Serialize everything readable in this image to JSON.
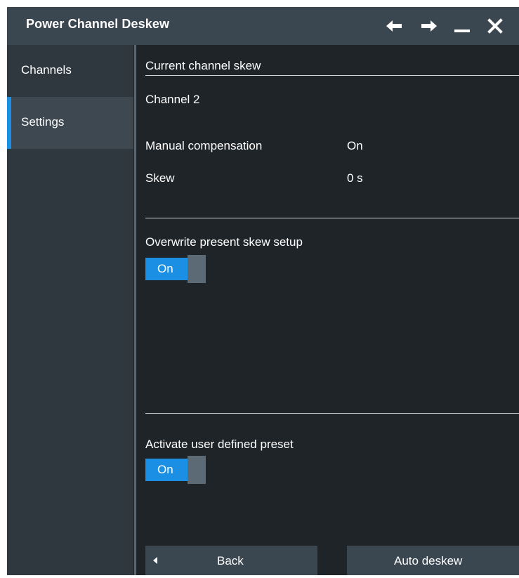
{
  "window": {
    "title": "Power Channel Deskew"
  },
  "sidebar": {
    "items": [
      {
        "label": "Channels",
        "active": false
      },
      {
        "label": "Settings",
        "active": true
      }
    ]
  },
  "content": {
    "section_header": "Current channel skew",
    "channel_name": "Channel 2",
    "manual_compensation_label": "Manual compensation",
    "manual_compensation_value": "On",
    "skew_label": "Skew",
    "skew_value": "0 s",
    "overwrite_label": "Overwrite present skew setup",
    "overwrite_toggle": "On",
    "activate_preset_label": "Activate user defined preset",
    "activate_preset_toggle": "On"
  },
  "buttons": {
    "back_label": "Back",
    "auto_deskew_label": "Auto deskew"
  },
  "colors": {
    "titlebar": "#3a4650",
    "background": "#1f2428",
    "sidebar": "#2f383f",
    "accent": "#1a8fe3"
  }
}
